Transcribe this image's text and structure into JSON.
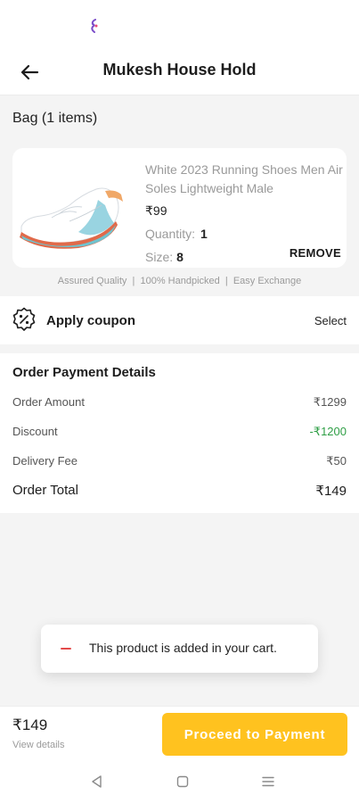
{
  "header": {
    "title": "Mukesh House Hold"
  },
  "bag": {
    "title": "Bag (1 items)",
    "product": {
      "name": "White 2023 Running Shoes Men Air Soles Lightweight Male",
      "price": "₹99",
      "quantity_label": "Quantity:",
      "quantity": "1",
      "size_label": "Size:",
      "size": "8",
      "remove_label": "REMOVE"
    },
    "assurance": "Assured Quality  |  100% Handpicked  |  Easy Exchange"
  },
  "coupon": {
    "label": "Apply coupon",
    "action": "Select"
  },
  "payment": {
    "title": "Order Payment Details",
    "order_amount_label": "Order Amount",
    "order_amount": "₹1299",
    "discount_label": "Discount",
    "discount": "-₹1200",
    "delivery_label": "Delivery Fee",
    "delivery": "₹50",
    "total_label": "Order Total",
    "total": "₹149"
  },
  "toast": {
    "message": "This product is added in your cart."
  },
  "footer": {
    "total": "₹149",
    "view_details": "View details",
    "proceed_label": "Proceed to Payment"
  },
  "colors": {
    "accent": "#ffc21f",
    "discount": "#2e9e45",
    "background": "#f4f4f4"
  },
  "icons": {
    "back": "arrow-left-icon",
    "coupon": "percent-badge-icon",
    "nav_back": "triangle-back-icon",
    "nav_home": "square-home-icon",
    "nav_menu": "menu-lines-icon"
  }
}
